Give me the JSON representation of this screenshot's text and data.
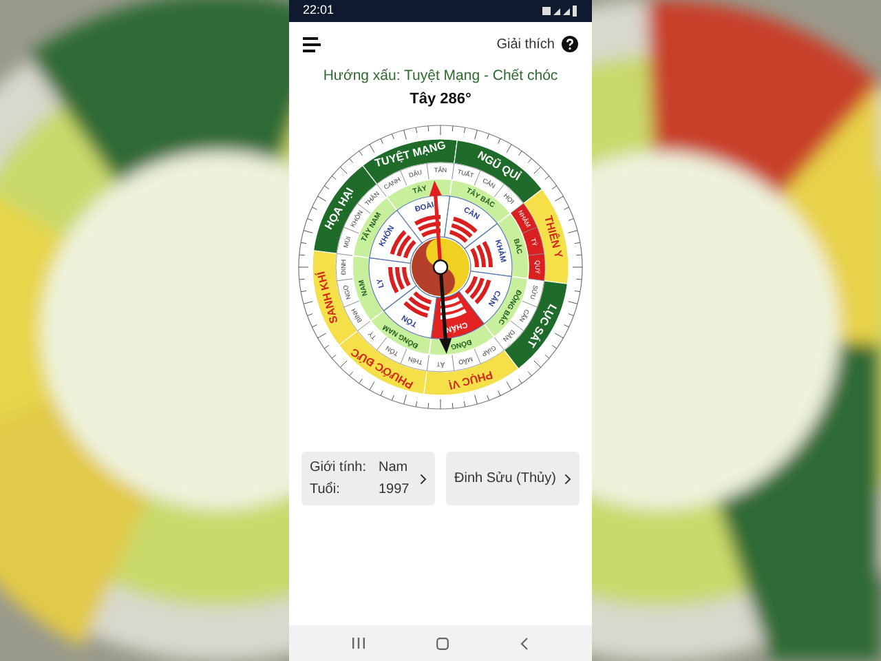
{
  "status_bar": {
    "time": "22:01"
  },
  "header": {
    "help_label": "Giải thích"
  },
  "direction": {
    "verdict": "Hướng xấu: Tuyệt Mạng - Chết chóc",
    "heading": "Tây 286°"
  },
  "compass": {
    "sectors": [
      {
        "label": "TUYỆT MẠNG",
        "color": "#1e6b2a"
      },
      {
        "label": "NGŨ QUỈ",
        "color": "#1e6b2a"
      },
      {
        "label": "THIÊN Y",
        "color": "#f5e04a"
      },
      {
        "label": "LỤC SÁT",
        "color": "#1e6b2a"
      },
      {
        "label": "PHỤC VỊ",
        "color": "#f5e04a"
      },
      {
        "label": "PHƯỚC ĐỨC",
        "color": "#f5e04a"
      },
      {
        "label": "SANH KHÍ",
        "color": "#f5e04a"
      },
      {
        "label": "HỌA HẠI",
        "color": "#1e6b2a"
      }
    ],
    "mountains": [
      "CANH",
      "DẬU",
      "TÂN",
      "TUẤT",
      "CÀN",
      "HỢI",
      "NHÂM",
      "TÝ",
      "QUÝ",
      "SỬU",
      "CẤN",
      "DẦN",
      "GIÁP",
      "MÃO",
      "ẤT",
      "THÌN",
      "TỐN",
      "TỴ",
      "BÍNH",
      "NGỌ",
      "ĐINH",
      "MÙI",
      "KHÔN",
      "THÂN"
    ],
    "directions": [
      "TÂY",
      "TÂY BẮC",
      "BẮC",
      "ĐÔNG BẮC",
      "ĐÔNG",
      "ĐÔNG NAM",
      "NAM",
      "TÂY NAM"
    ],
    "trigrams": [
      {
        "label": "ĐOÀI",
        "selected": false
      },
      {
        "label": "CÀN",
        "selected": false
      },
      {
        "label": "KHẢM",
        "selected": false
      },
      {
        "label": "CẤN",
        "selected": false
      },
      {
        "label": "CHẤN",
        "selected": true
      },
      {
        "label": "TỐN",
        "selected": false
      },
      {
        "label": "LY",
        "selected": false
      },
      {
        "label": "KHÔN",
        "selected": false
      }
    ]
  },
  "cards": [
    {
      "kind": "profile",
      "rows": [
        {
          "label": "Giới tính:",
          "value": "Nam"
        },
        {
          "label": "Tuổi:",
          "value": "1997"
        }
      ]
    },
    {
      "kind": "element",
      "text": "Đinh Sửu (Thủy)"
    }
  ]
}
